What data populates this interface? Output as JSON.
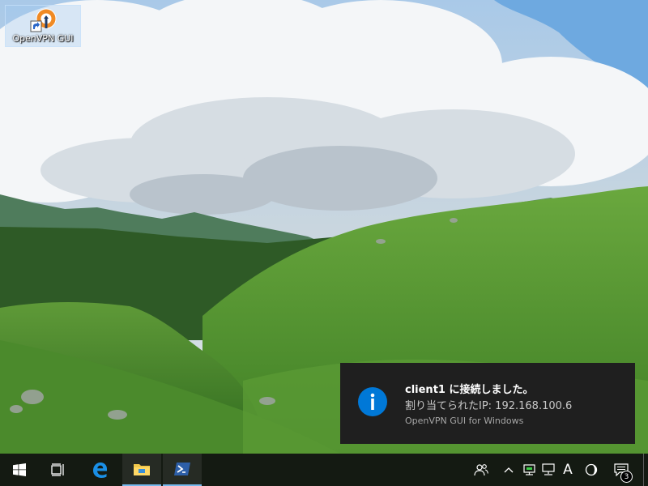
{
  "desktop": {
    "icons": [
      {
        "label": "OpenVPN GUI",
        "icon": "openvpn-icon"
      }
    ]
  },
  "toast": {
    "icon": "info-icon",
    "title": "client1 に接続しました。",
    "body": "割り当てられたIP: 192.168.100.6",
    "source": "OpenVPN GUI for Windows",
    "accent": "#0078d7"
  },
  "taskbar": {
    "buttons": [
      {
        "icon": "windows-start-icon",
        "active": false
      },
      {
        "icon": "task-view-icon",
        "active": false
      },
      {
        "icon": "edge-icon",
        "active": false
      },
      {
        "icon": "file-explorer-icon",
        "active": true
      },
      {
        "icon": "powershell-icon",
        "active": true
      }
    ],
    "tray": {
      "people_icon": "people-icon",
      "overflow_icon": "chevron-up-icon",
      "network_icon": "network-icon",
      "ime_indicator": "A",
      "night_icon": "moon-icon",
      "action_center_icon": "action-center-icon",
      "notification_count": "3"
    },
    "accent": "#76b9ed"
  }
}
